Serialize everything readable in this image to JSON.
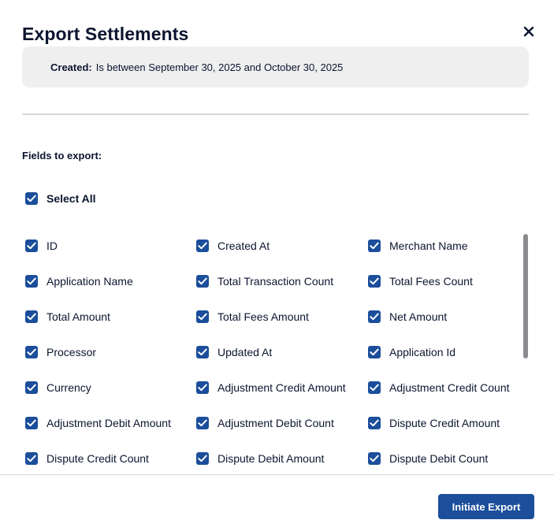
{
  "modal": {
    "title": "Export Settlements",
    "close_icon": "close-icon"
  },
  "filter": {
    "label": "Created:",
    "value": "Is between September 30, 2025 and October 30, 2025"
  },
  "fields_heading": "Fields to export:",
  "select_all": {
    "label": "Select All",
    "checked": true
  },
  "fields": [
    [
      "ID",
      "Created At",
      "Merchant Name"
    ],
    [
      "Application Name",
      "Total Transaction Count",
      "Total Fees Count"
    ],
    [
      "Total Amount",
      "Total Fees Amount",
      "Net Amount"
    ],
    [
      "Processor",
      "Updated At",
      "Application Id"
    ],
    [
      "Currency",
      "Adjustment Credit Amount",
      "Adjustment Credit Count"
    ],
    [
      "Adjustment Debit Amount",
      "Adjustment Debit Count",
      "Dispute Credit Amount"
    ],
    [
      "Dispute Credit Count",
      "Dispute Debit Amount",
      "Dispute Debit Count"
    ]
  ],
  "all_fields_checked": true,
  "footer": {
    "initiate_label": "Initiate Export"
  },
  "colors": {
    "accent": "#1b4e9b",
    "text": "#0c1530",
    "filter_bg": "#efefef"
  }
}
